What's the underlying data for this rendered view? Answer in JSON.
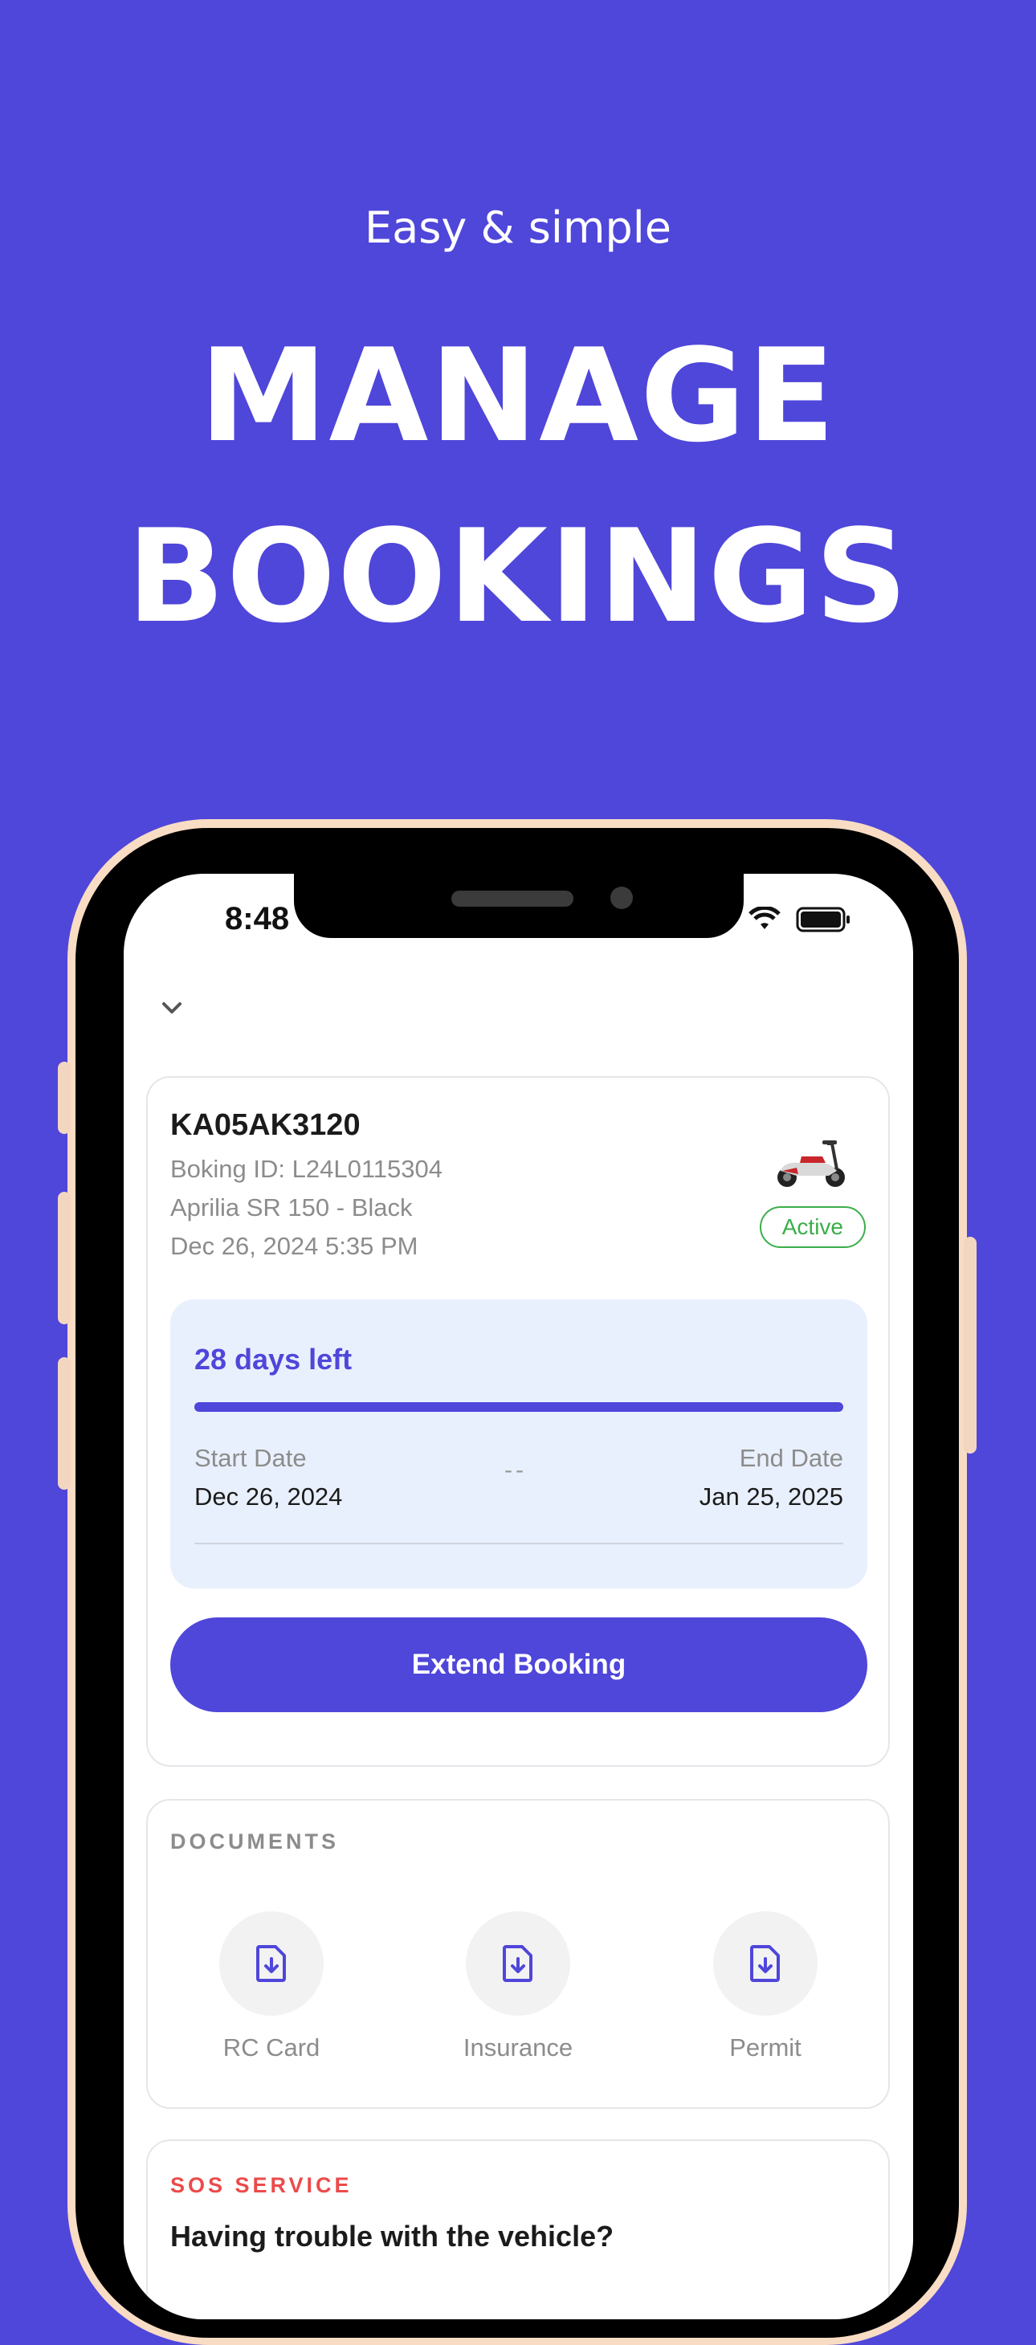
{
  "hero": {
    "subtitle": "Easy & simple",
    "title_line1": "MANAGE",
    "title_line2": "BOOKINGS"
  },
  "status_bar": {
    "time": "8:48"
  },
  "booking": {
    "plate": "KA05AK3120",
    "booking_id": "Boking ID: L24L0115304",
    "vehicle": "Aprilia SR 150 - Black",
    "datetime": "Dec 26, 2024 5:35 PM",
    "status": "Active",
    "days_left": "28 days left",
    "progress_fraction": 1.0,
    "start_label": "Start Date",
    "start_value": "Dec 26, 2024",
    "separator": "--",
    "end_label": "End Date",
    "end_value": "Jan 25, 2025",
    "extend_label": "Extend Booking"
  },
  "documents": {
    "title": "DOCUMENTS",
    "items": [
      {
        "label": "RC Card",
        "icon": "file-download-icon"
      },
      {
        "label": "Insurance",
        "icon": "file-download-icon"
      },
      {
        "label": "Permit",
        "icon": "file-download-icon"
      }
    ]
  },
  "sos": {
    "title": "SOS SERVICE",
    "question": "Having trouble with the vehicle?"
  },
  "colors": {
    "brand": "#4f46da",
    "active_green": "#3aae4a",
    "sos_red": "#ec4a4a",
    "period_bg": "#e9f0fd"
  }
}
